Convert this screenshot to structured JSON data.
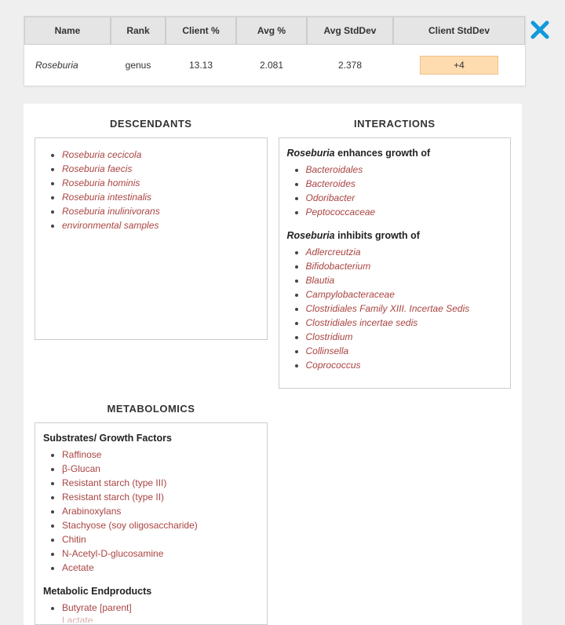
{
  "summary": {
    "headers": [
      "Name",
      "Rank",
      "Client %",
      "Avg %",
      "Avg StdDev",
      "Client StdDev"
    ],
    "row": {
      "name": "Roseburia",
      "rank": "genus",
      "client_pct": "13.13",
      "avg_pct": "2.081",
      "avg_stddev": "2.378",
      "client_stddev": "+4"
    }
  },
  "close_label": "Close",
  "descendants": {
    "title": "DESCENDANTS",
    "items": [
      "Roseburia cecicola",
      "Roseburia faecis",
      "Roseburia hominis",
      "Roseburia intestinalis",
      "Roseburia inulinivorans",
      "environmental samples"
    ]
  },
  "interactions": {
    "title": "INTERACTIONS",
    "subject": "Roseburia",
    "enhances_label_suffix": " enhances growth of",
    "enhances": [
      "Bacteroidales",
      "Bacteroides",
      "Odoribacter",
      "Peptococcaceae"
    ],
    "inhibits_label_suffix": " inhibits growth of",
    "inhibits": [
      "Adlercreutzia",
      "Bifidobacterium",
      "Blautia",
      "Campylobacteraceae",
      "Clostridiales Family XIII. Incertae Sedis",
      "Clostridiales incertae sedis",
      "Clostridium",
      "Collinsella",
      "Coprococcus"
    ]
  },
  "metabolomics": {
    "title": "METABOLOMICS",
    "substrates_label": "Substrates/ Growth Factors",
    "substrates": [
      "Raffinose",
      "β-Glucan",
      "Resistant starch (type III)",
      "Resistant starch (type II)",
      "Arabinoxylans",
      "Stachyose (soy oligosaccharide)",
      "Chitin",
      "N-Acetyl-D-glucosamine",
      "Acetate"
    ],
    "endproducts_label": "Metabolic Endproducts",
    "endproducts": [
      "Butyrate [parent]",
      "Lactate"
    ]
  }
}
